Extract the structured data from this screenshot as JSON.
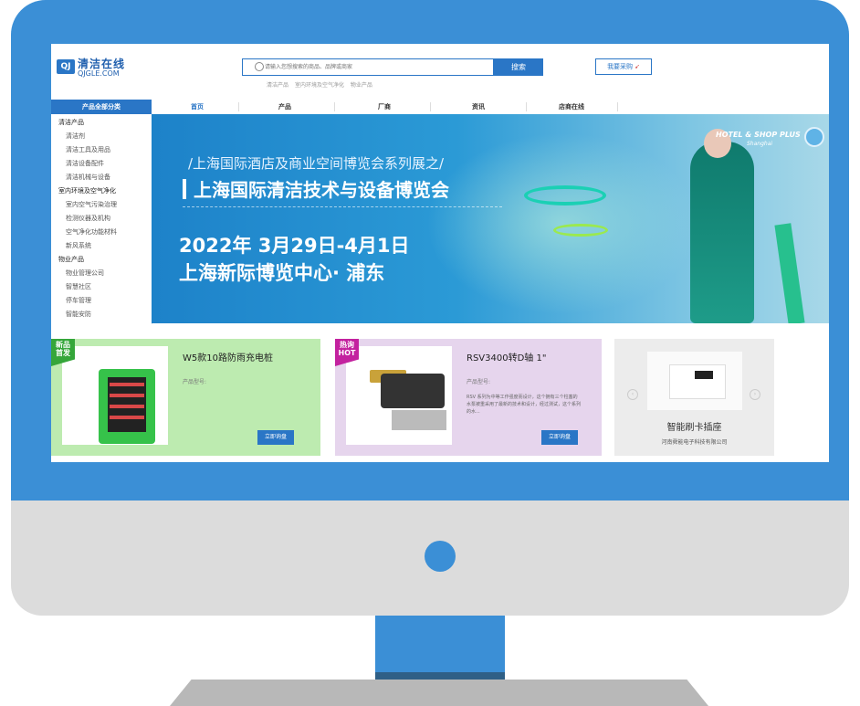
{
  "logo": {
    "badge": "QJ",
    "name": "清洁在线",
    "domain": "QJGLE.COM"
  },
  "search": {
    "placeholder": "请输入您想搜索的商品、品牌或商家",
    "button": "搜索"
  },
  "hot_keywords": [
    "清洁产品",
    "室内环境及空气净化",
    "物业产品"
  ],
  "buy_button": "我要采购",
  "nav": {
    "all_categories": "产品全部分类",
    "items": [
      "首页",
      "产品",
      "厂商",
      "资讯",
      "店商在线"
    ]
  },
  "sidebar": [
    {
      "label": "清洁产品",
      "type": "cat"
    },
    {
      "label": "清洁剂",
      "type": "sub"
    },
    {
      "label": "清洁工具及用品",
      "type": "sub"
    },
    {
      "label": "清洁设备配件",
      "type": "sub"
    },
    {
      "label": "清洁机械与设备",
      "type": "sub"
    },
    {
      "label": "室内环境及空气净化",
      "type": "cat"
    },
    {
      "label": "室内空气污染治理",
      "type": "sub"
    },
    {
      "label": "检测仪器及机构",
      "type": "sub"
    },
    {
      "label": "空气净化功能材料",
      "type": "sub"
    },
    {
      "label": "新风系统",
      "type": "sub"
    },
    {
      "label": "物业产品",
      "type": "cat"
    },
    {
      "label": "物业管理公司",
      "type": "sub"
    },
    {
      "label": "智慧社区",
      "type": "sub"
    },
    {
      "label": "停车管理",
      "type": "sub"
    },
    {
      "label": "智能安防",
      "type": "sub"
    }
  ],
  "banner": {
    "subtitle": "/上海国际酒店及商业空间博览会系列展之/",
    "title": "上海国际清洁技术与设备博览会",
    "date": "2022年 3月29日-4月1日",
    "venue": "上海新际博览中心· 浦东",
    "logo": "HOTEL & SHOP PLUS",
    "logo_city": "Shanghai"
  },
  "products": [
    {
      "tag_line1": "新品",
      "tag_line2": "首发",
      "title": "W5款10路防雨充电桩",
      "model_label": "产品型号:",
      "description": "",
      "button": "立即询盘"
    },
    {
      "tag_line1": "热询",
      "tag_line2": "HOT",
      "title": "RSV3400转D轴 1\"",
      "model_label": "产品型号:",
      "description": "RSV 系列为中等工作强度而设计，这个拥有三个柱塞的水泵被重采用了最新的技术和设计，经过测试，这个系列的水...",
      "button": "立即询盘"
    },
    {
      "title": "智能刷卡插座",
      "company": "河南舜能电子科技有限公司"
    }
  ],
  "colors": {
    "brand": "#2a76c6",
    "monitor": "#3b8fd6",
    "card_green": "#bdebb0",
    "card_purple": "#e6d5ed",
    "tag_green": "#35a63a",
    "tag_magenta": "#c3229f"
  }
}
